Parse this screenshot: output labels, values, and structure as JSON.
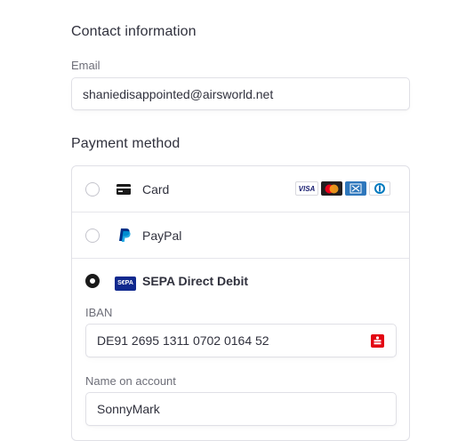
{
  "contact": {
    "title": "Contact information",
    "email_label": "Email",
    "email_value": "shaniedisappointed@airsworld.net"
  },
  "payment": {
    "title": "Payment method",
    "options": [
      {
        "label": "Card",
        "selected": false
      },
      {
        "label": "PayPal",
        "selected": false
      },
      {
        "label": "SEPA Direct Debit",
        "selected": true
      }
    ],
    "card_brands": [
      "VISA",
      "mastercard-icon",
      "amex-icon",
      "diners-icon"
    ],
    "sepa_badge": "S€PA",
    "iban_label": "IBAN",
    "iban_value": "DE91 2695 1311 0702 0164 52",
    "name_label": "Name on account",
    "name_value": "SonnyMark"
  },
  "colors": {
    "visa": "#1a1f71",
    "mastercard_bg": "#231f20",
    "amex": "#2e77bc",
    "bank_icon": "#e30613",
    "sepa": "#10298e"
  }
}
